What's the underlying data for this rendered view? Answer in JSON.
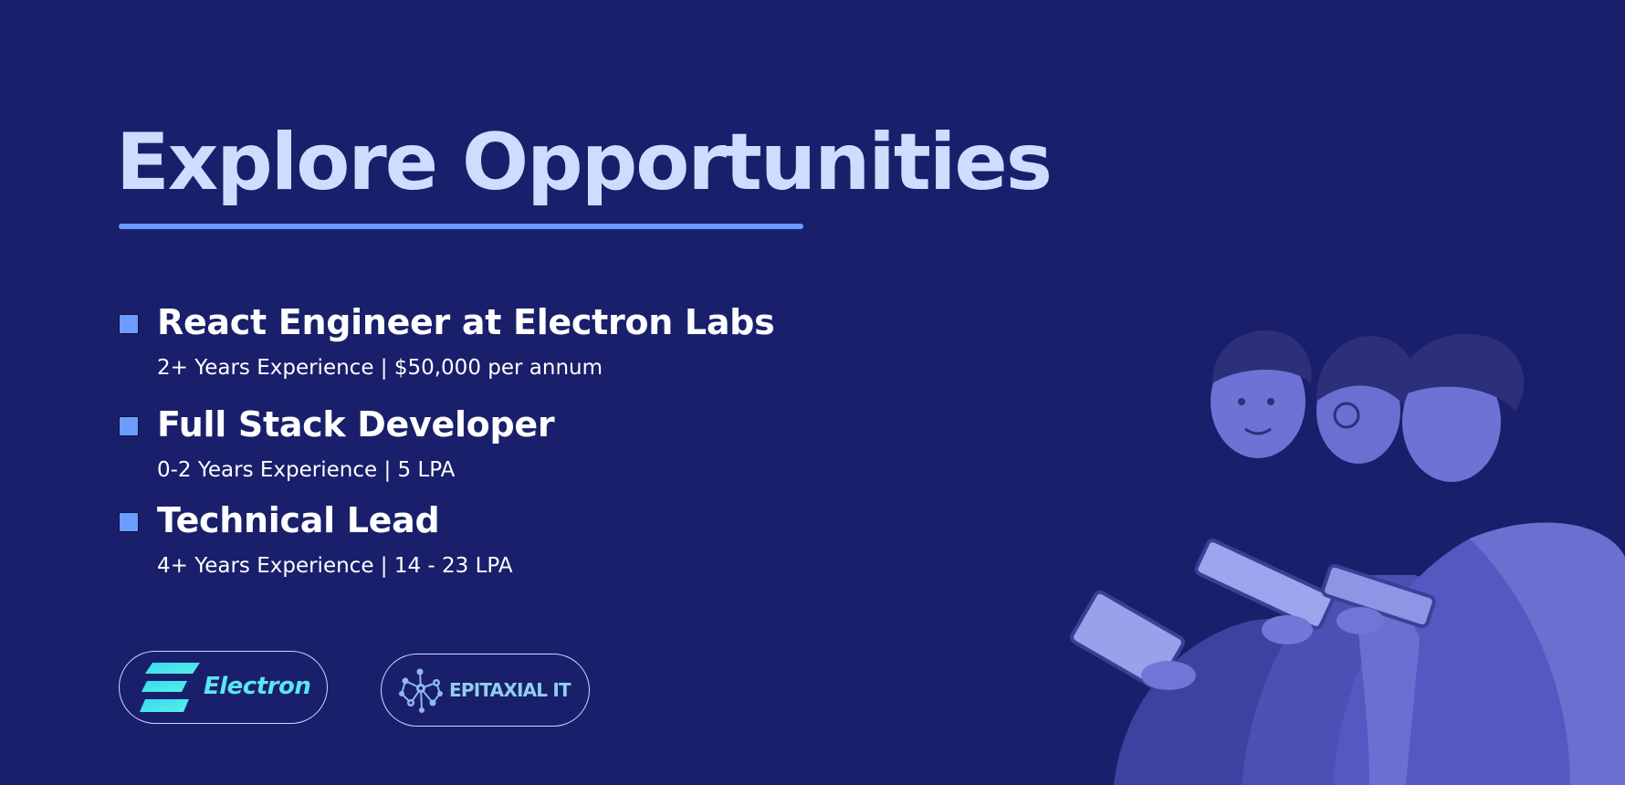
{
  "header": {
    "title": "Explore Opportunities"
  },
  "jobs": [
    {
      "title": "React Engineer at Electron Labs",
      "details": "2+ Years Experience | $50,000 per annum"
    },
    {
      "title": "Full Stack Developer",
      "details": "0-2 Years Experience | 5 LPA"
    },
    {
      "title": "Technical Lead",
      "details": "4+ Years Experience | 14 - 23 LPA"
    }
  ],
  "partners": [
    {
      "name": "Electron",
      "icon": "electron-logo-icon"
    },
    {
      "name": "EPITAXIAL IT",
      "icon": "molecule-network-icon"
    }
  ],
  "photo": {
    "description_icon": "students-with-tablets-photo"
  },
  "colors": {
    "background": "#1a1f6b",
    "title": "#cfdcff",
    "accent": "#6b9bff",
    "electron_brand": "#5ae6f0",
    "epitaxial_brand": "#8fd0ec"
  }
}
